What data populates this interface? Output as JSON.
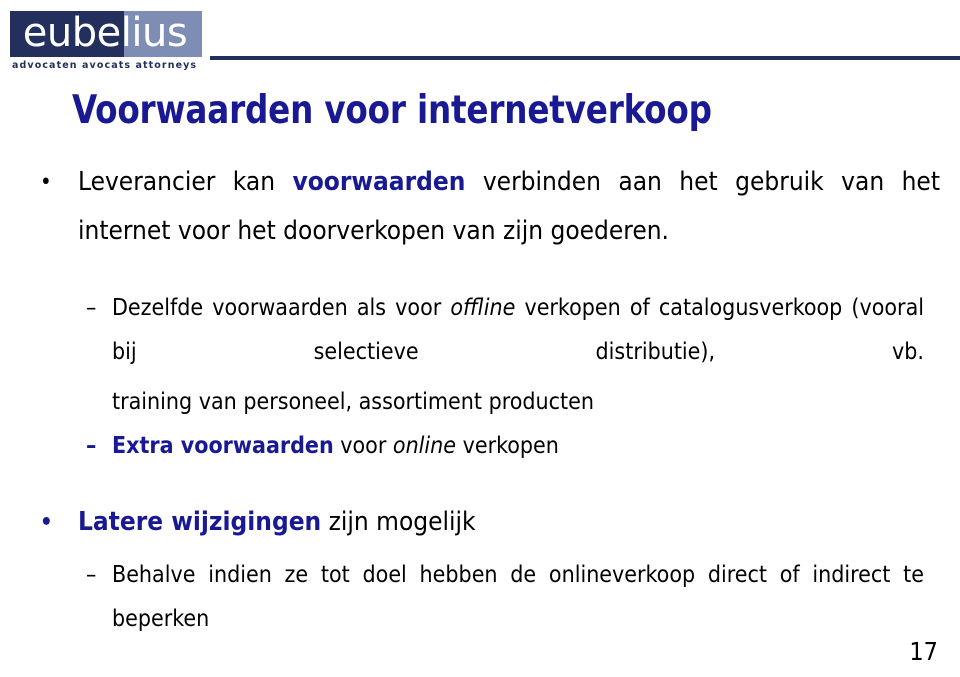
{
  "header": {
    "logo": {
      "wordmark": "eubelius",
      "tagline": "advocaten  avocats  attorneys",
      "dark_color": "#23305e",
      "light_color": "#7e8db4",
      "text_color": "#ffffff"
    },
    "rule_color": "#23305e"
  },
  "title": {
    "text": "Voorwaarden voor internetverkoop",
    "color": "#191993"
  },
  "body": {
    "accent_color": "#191993",
    "text_color": "#000000",
    "blocks": [
      {
        "level": 1,
        "marker": "•",
        "segments": [
          {
            "text": "Leverancier kan ",
            "style": "normal"
          },
          {
            "text": "voorwaarden",
            "style": "bold-accent"
          },
          {
            "text": " verbinden aan het gebruik van het internet voor het doorverkopen van zijn goederen.",
            "style": "normal"
          }
        ],
        "plain": "Leverancier kan voorwaarden verbinden aan het gebruik van het internet voor het doorverkopen van zijn goederen."
      },
      {
        "level": 2,
        "marker": "–",
        "segments": [
          {
            "text": "Dezelfde voorwaarden als voor ",
            "style": "normal"
          },
          {
            "text": "offline",
            "style": "italic"
          },
          {
            "text": " verkopen of catalogusverkoop (vooral bij selectieve distributie), vb.",
            "style": "normal"
          }
        ],
        "plain": "Dezelfde voorwaarden als voor offline verkopen of catalogusverkoop (vooral bij selectieve distributie), vb."
      },
      {
        "level": 2,
        "marker": "",
        "segments": [
          {
            "text": "training van personeel, assortiment producten",
            "style": "normal"
          }
        ],
        "plain": "training van personeel, assortiment producten"
      },
      {
        "level": 2,
        "marker": "–",
        "segments": [
          {
            "text": "Extra voorwaarden",
            "style": "bold-accent"
          },
          {
            "text": " voor ",
            "style": "normal"
          },
          {
            "text": "online",
            "style": "italic"
          },
          {
            "text": " verkopen",
            "style": "normal"
          }
        ],
        "plain": "Extra voorwaarden voor online verkopen"
      },
      {
        "level": 1,
        "marker": "•",
        "segments": [
          {
            "text": "Latere wijzigingen",
            "style": "bold-accent"
          },
          {
            "text": " zijn mogelijk",
            "style": "normal"
          }
        ],
        "plain": "Latere wijzigingen zijn mogelijk"
      },
      {
        "level": 2,
        "marker": "–",
        "segments": [
          {
            "text": "Behalve indien ze tot doel hebben de onlineverkoop direct of indirect te beperken",
            "style": "normal"
          }
        ],
        "plain": "Behalve indien ze tot doel hebben de onlineverkoop direct of indirect te beperken"
      }
    ]
  },
  "footer": {
    "page_number": "17"
  }
}
